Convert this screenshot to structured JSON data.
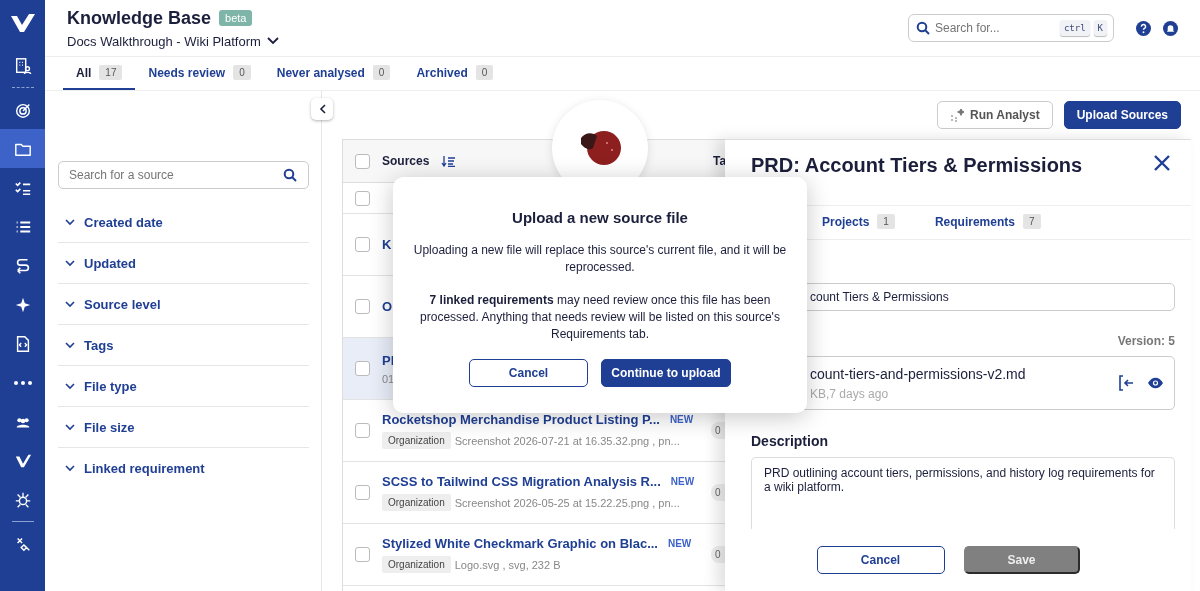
{
  "sidebar": {
    "items": [
      {
        "selected": false
      },
      {
        "selected": false
      },
      {
        "selected": true
      },
      {
        "selected": false
      },
      {
        "selected": false
      },
      {
        "selected": false
      },
      {
        "selected": false
      },
      {
        "selected": false
      },
      {
        "selected": false
      },
      {
        "selected": false
      },
      {
        "selected": false
      },
      {
        "selected": false
      },
      {
        "selected": false
      }
    ]
  },
  "header": {
    "title": "Knowledge Base",
    "badge": "beta",
    "project": "Docs Walkthrough - Wiki Platform",
    "search": {
      "placeholder": "Search for...",
      "keys": [
        "ctrl",
        "K"
      ]
    }
  },
  "tabs": [
    {
      "label": "All",
      "count": "17",
      "selected": true
    },
    {
      "label": "Needs review",
      "count": "0",
      "selected": false
    },
    {
      "label": "Never analysed",
      "count": "0",
      "selected": false
    },
    {
      "label": "Archived",
      "count": "0",
      "selected": false
    }
  ],
  "filters": {
    "search": {
      "placeholder": "Search for a source"
    },
    "groups": [
      "Created date",
      "Updated",
      "Source level",
      "Tags",
      "File type",
      "File size",
      "Linked requirement"
    ]
  },
  "toolbar": {
    "buttons": [
      {
        "label": "Run Analyst",
        "kind": "secondary"
      },
      {
        "label": "Upload Sources",
        "kind": "primary"
      }
    ]
  },
  "list": {
    "columns": [
      "Sources",
      "Ta"
    ],
    "select_all": {
      "checked": false
    },
    "rows": [
      {
        "kind": "partial",
        "checked": false,
        "selected": false
      },
      {
        "kind": "covered",
        "title": "K",
        "checked": false,
        "selected": false
      },
      {
        "kind": "covered",
        "title": "O",
        "checked": false,
        "selected": false
      },
      {
        "kind": "covered",
        "title": "Pl",
        "subtitle": "01",
        "checked": false,
        "selected": true
      },
      {
        "kind": "full",
        "title": "Rocketshop Merchandise Product Listing P...",
        "badge": "NEW",
        "chip": "Organization",
        "meta": "Screenshot 2026-07-21 at 16.35.32.png , pn...",
        "count": "0",
        "checked": false,
        "selected": false
      },
      {
        "kind": "full",
        "title": "SCSS to Tailwind CSS Migration Analysis R...",
        "badge": "NEW",
        "chip": "Organization",
        "meta": "Screenshot 2026-05-25 at 15.22.25.png , pn...",
        "count": "0",
        "checked": false,
        "selected": false
      },
      {
        "kind": "full",
        "title": "Stylized White Checkmark Graphic on Blac...",
        "badge": "NEW",
        "chip": "Organization",
        "meta": "Logo.svg , svg, 232 B",
        "count": "0",
        "checked": false,
        "selected": false
      }
    ]
  },
  "detail": {
    "title": "PRD: Account Tiers & Permissions",
    "tabs": [
      {
        "label": "Projects",
        "count": "1",
        "selected": false
      },
      {
        "label": "Requirements",
        "count": "7",
        "selected": false
      }
    ],
    "name_value": "count Tiers & Permissions",
    "version": "Version: 5",
    "file": {
      "name": "count-tiers-and-permissions-v2.md",
      "meta": "KB,7 days ago"
    },
    "description_label": "Description",
    "description": "PRD outlining account tiers, permissions, and history log requirements for a wiki platform.",
    "buttons": [
      {
        "label": "Cancel",
        "kind": "secondary",
        "disabled": false
      },
      {
        "label": "Save",
        "kind": "primary",
        "disabled": true
      }
    ]
  },
  "modal": {
    "title": "Upload a new source file",
    "paragraphs": [
      "Uploading a new file will replace this source's current file, and it will be reprocessed.",
      "**7 linked requirements** may need review once this file has been processed. Anything that needs review will be listed on this source's Requirements tab."
    ],
    "buttons": [
      {
        "label": "Cancel",
        "kind": "secondary"
      },
      {
        "label": "Continue to upload",
        "kind": "primary"
      }
    ]
  }
}
